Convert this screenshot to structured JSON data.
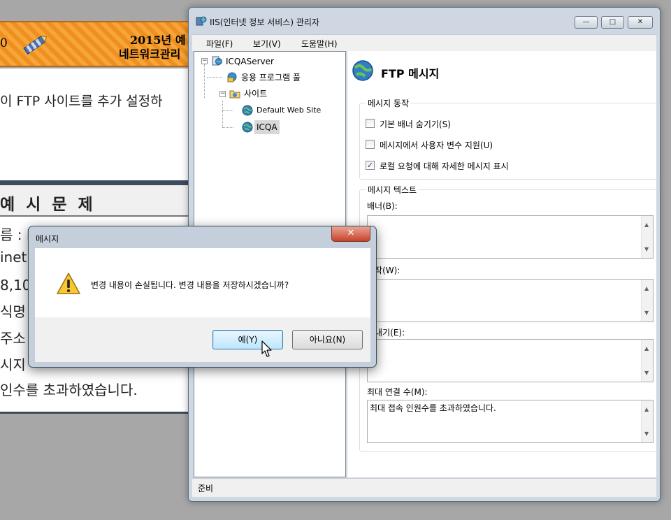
{
  "background_doc": {
    "banner_number": "0",
    "banner_line1": "2015년 예",
    "banner_line2": "네트워크관리",
    "intro_text": "이 FTP 사이트를 추가 설정하",
    "section_title": "예 시 문 제",
    "lines": [
      "름 : I",
      "inetp",
      "8,10",
      "식명",
      "주소",
      "시지",
      "인수를 초과하였습니다."
    ]
  },
  "window": {
    "title": "IIS(인터넷 정보 서비스) 관리자",
    "controls": {
      "minimize": "—",
      "maximize": "□",
      "close": "✕"
    },
    "menu": [
      "파일(F)",
      "보기(V)",
      "도움말(H)"
    ],
    "tree": {
      "server": "ICQAServer",
      "app_pool": "응용 프로그램 풀",
      "sites": "사이트",
      "default_site": "Default Web Site",
      "icqa": "ICQA",
      "expander_minus": "−"
    },
    "page_title": "FTP 메시지",
    "message_behavior": {
      "title": "메시지 동작",
      "options": [
        {
          "label": "기본 배너 숨기기(S)",
          "checked": false,
          "mark": ""
        },
        {
          "label": "메시지에서 사용자 변수 지원(U)",
          "checked": false,
          "mark": ""
        },
        {
          "label": "로컬 요청에 대해 자세한 메시지 표시",
          "checked": true,
          "mark": "✓"
        }
      ]
    },
    "message_text": {
      "title": "메시지 텍스트",
      "banner_label": "배너(B):",
      "welcome_label": "시작(W):",
      "exit_label": "끝내기(E):",
      "max_label": "최대 연결 수(M):",
      "max_value": "최대 접속 인원수를 초과하였습니다.",
      "scroll_up": "▲",
      "scroll_down": "▼"
    },
    "status": "준비"
  },
  "dialog": {
    "title": "메시지",
    "close": "✕",
    "message": "변경 내용이 손실됩니다. 변경 내용을 저장하시겠습니까?",
    "yes": "예(Y)",
    "no": "아니요(N)"
  },
  "colors": {
    "accent": "#3c7fb1",
    "banner": "#f5a53a",
    "window_frame": "#cfd8e2"
  }
}
